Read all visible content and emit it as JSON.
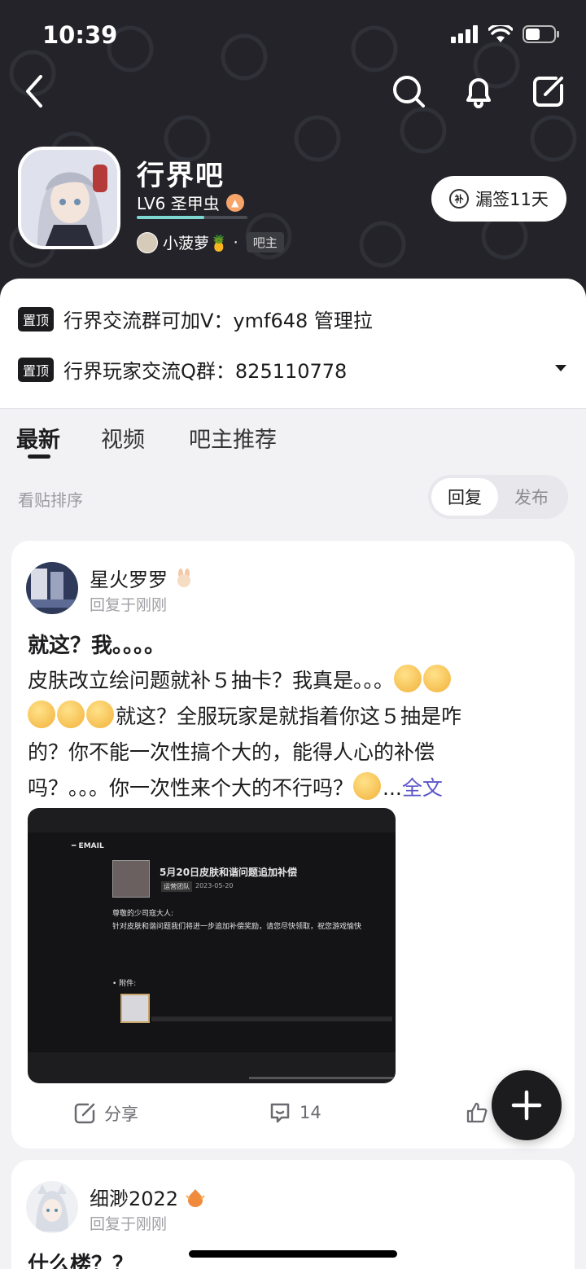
{
  "status_bar": {
    "time": "10:39"
  },
  "forum": {
    "name": "行界吧",
    "level_text": "LV6 圣甲虫",
    "level_progress": 0.61,
    "owner_name": "小菠萝🍍",
    "owner_separator": "·",
    "owner_tag": "吧主",
    "sign_icon_text": "补",
    "sign_label": "漏签11天"
  },
  "pinned": [
    {
      "tag": "置顶",
      "text": "行界交流群可加V：ymf648   管理拉"
    },
    {
      "tag": "置顶",
      "text": "行界玩家交流Q群：825110778"
    }
  ],
  "tabs": [
    {
      "label": "最新",
      "active": true
    },
    {
      "label": "视频",
      "active": false
    },
    {
      "label": "吧主推荐",
      "active": false
    }
  ],
  "sort": {
    "label": "看贴排序",
    "options": [
      "回复",
      "发布"
    ],
    "selected": "回复"
  },
  "posts": [
    {
      "user": "星火罗罗",
      "meta": "回复于刚刚",
      "title": "就这？我。。。。",
      "body_line1": "皮肤改立绘问题就补５抽卡？我真是。。。",
      "body_line2": "就这？全服玩家是就指着你这５抽是咋",
      "body_line3": "的？你不能一次性搞个大的，能得人心的补偿",
      "body_line4": "吗？。。。你一次性来个大的不行吗？",
      "ellipsis": "...",
      "full_link": "全文",
      "image": {
        "email_label": "━ EMAIL",
        "mail_title": "5月20日皮肤和谐问题追加补偿",
        "sender": "运营团队",
        "date": "2023-05-20",
        "greeting": "尊敬的少司寇大人:",
        "content": "针对皮肤和谐问题我们将进一步追加补偿奖励，请您尽快领取，祝您游戏愉快",
        "attachment_label": "• 附件:"
      },
      "share_label": "分享",
      "comment_count": "14"
    },
    {
      "user": "细渺2022",
      "meta": "回复于刚刚",
      "title": "什么楼？？"
    }
  ]
}
